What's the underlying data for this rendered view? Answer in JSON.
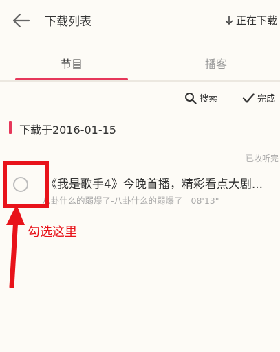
{
  "header": {
    "title": "下载列表",
    "downloading_label": "正在下载",
    "back_icon": "arrow-left-icon"
  },
  "tabs": [
    {
      "label": "节目",
      "active": true
    },
    {
      "label": "播客",
      "active": false
    }
  ],
  "toolbar": {
    "search_label": "搜索",
    "done_label": "完成"
  },
  "section": {
    "title": "下载于2016-01-15"
  },
  "list": {
    "listened_label": "已收听完",
    "items": [
      {
        "title": "《我是歌手4》今晚首播，精彩看点大剧...",
        "author": "八卦什么的弱爆了-八卦什么的弱爆了",
        "duration": "08'13\"",
        "selected": false
      }
    ]
  },
  "annotation": {
    "text": "勾选这里"
  },
  "colors": {
    "accent": "#e6375a",
    "annotation": "#e8131a",
    "background": "#fdfbf6"
  }
}
